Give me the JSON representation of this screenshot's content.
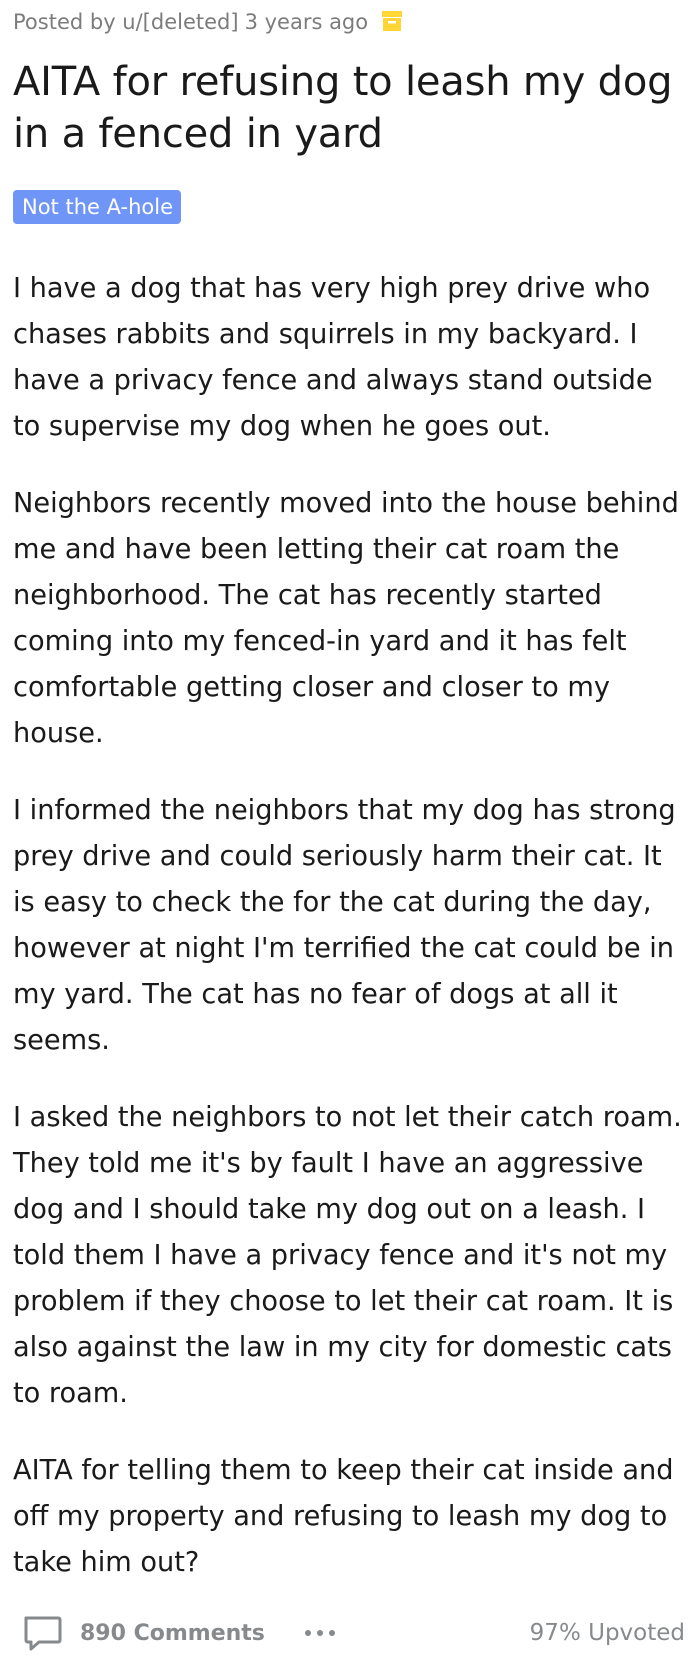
{
  "post": {
    "author_prefix": "Posted by u/[deleted]",
    "time": "3 years ago",
    "archived_icon": "archive-box-icon",
    "title": "AITA for refusing to leash my dog in a fenced in yard",
    "flair": "Not the A-hole",
    "paragraphs": [
      "I have a dog that has very high prey drive who chases rabbits and squirrels in my backyard. I have a privacy fence and always stand outside to supervise my dog when he goes out.",
      "Neighbors recently moved into the house behind me and have been letting their cat roam the neighborhood. The cat has recently started coming into my fenced-in yard and it has felt comfortable getting closer and closer to my house.",
      "I informed the neighbors that my dog has strong prey drive and could seriously harm their cat. It is easy to check the for the cat during the day, however at night I'm terrified the cat could be in my yard. The cat has no fear of dogs at all it seems.",
      "I asked the neighbors to not let their catch roam. They told me it's by fault I have an aggressive dog and I should take my dog out on a leash. I told them I have a privacy fence and it's not my problem if they choose to let their cat roam. It is also against the law in my city for domestic cats to roam.",
      "AITA for telling them to keep their cat inside and off my property and refusing to leash my dog to take him out?"
    ]
  },
  "footer": {
    "comments_icon": "comment-bubble-icon",
    "comments_label": "890 Comments",
    "more_icon": "more-horizontal-icon",
    "upvoted": "97% Upvoted"
  },
  "colors": {
    "flair_bg": "#6f95f7",
    "archive_icon": "#ffd635",
    "muted_text": "#878a8c"
  }
}
